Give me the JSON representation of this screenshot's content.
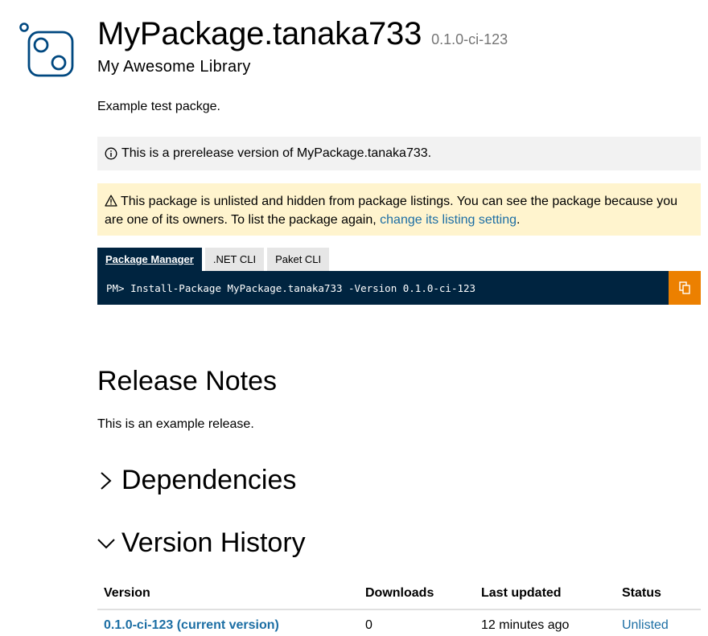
{
  "package": {
    "name": "MyPackage.tanaka733",
    "version": "0.1.0-ci-123",
    "subtitle": "My Awesome Library",
    "description": "Example test packge."
  },
  "alerts": {
    "prerelease": "This is a prerelease version of MyPackage.tanaka733.",
    "unlisted_text": "This package is unlisted and hidden from package listings. You can see the package because you are one of its owners. To list the package again, ",
    "unlisted_link": "change its listing setting",
    "unlisted_end": "."
  },
  "install": {
    "tabs": [
      "Package Manager",
      ".NET CLI",
      "Paket CLI"
    ],
    "active_tab": "Package Manager",
    "command": "PM> Install-Package MyPackage.tanaka733 -Version 0.1.0-ci-123",
    "copy_icon": "copy-icon"
  },
  "release_notes": {
    "heading": "Release Notes",
    "text": "This is an example release."
  },
  "dependencies": {
    "heading": "Dependencies",
    "expanded": false
  },
  "version_history": {
    "heading": "Version History",
    "expanded": true,
    "columns": [
      "Version",
      "Downloads",
      "Last updated",
      "Status"
    ],
    "rows": [
      {
        "version": "0.1.0-ci-123 (current version)",
        "downloads": "0",
        "updated": "12 minutes ago",
        "status": "Unlisted"
      }
    ]
  },
  "colors": {
    "brand_dark": "#002440",
    "accent_orange": "#ec8000",
    "link": "#1c6ea4",
    "warning_bg": "#fff4ce",
    "info_bg": "#f2f2f2"
  }
}
